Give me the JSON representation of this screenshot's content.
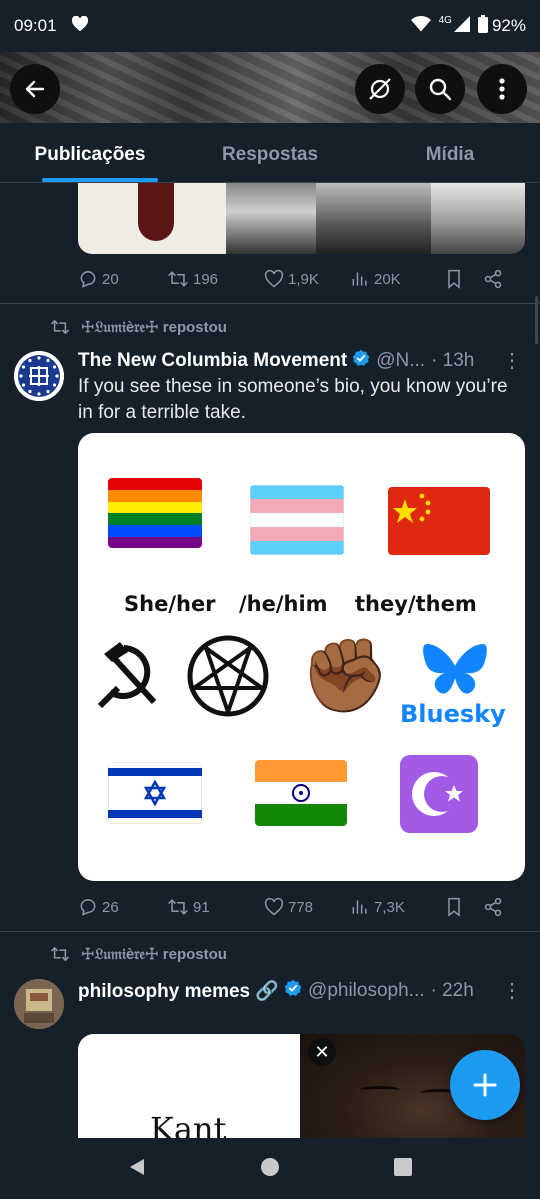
{
  "status_bar": {
    "time": "09:01",
    "network": "4G",
    "battery": "92%"
  },
  "tabs": [
    {
      "label": "Publicações",
      "active": true
    },
    {
      "label": "Respostas",
      "active": false
    },
    {
      "label": "Mídia",
      "active": false
    }
  ],
  "post1": {
    "stats": {
      "replies": "20",
      "reposts": "196",
      "likes": "1,9K",
      "views": "20K"
    }
  },
  "post2": {
    "repost_label": "☩𝔏𝔲𝔪𝔦è𝔯𝔢☩ repostou",
    "name": "The New Columbia Movement",
    "handle": "@N...",
    "time": "· 13h",
    "text": "If you see these in someone’s bio, you know you’re in for a terrible take.",
    "media": {
      "pronouns": [
        "She/her",
        "/he/him",
        "they/them"
      ],
      "bluesky": "Bluesky",
      "emoji": {
        "fist": "✊🏾"
      }
    },
    "stats": {
      "replies": "26",
      "reposts": "91",
      "likes": "778",
      "views": "7,3K"
    }
  },
  "post3": {
    "repost_label": "☩𝔏𝔲𝔪𝔦è𝔯𝔢☩ repostou",
    "name": "philosophy memes 🔗",
    "handle": "@philosoph...",
    "time": "· 22h",
    "media_text": "Kant"
  },
  "colors": {
    "accent": "#1d9bf0",
    "background": "#15202b",
    "muted": "#8b98a5"
  }
}
